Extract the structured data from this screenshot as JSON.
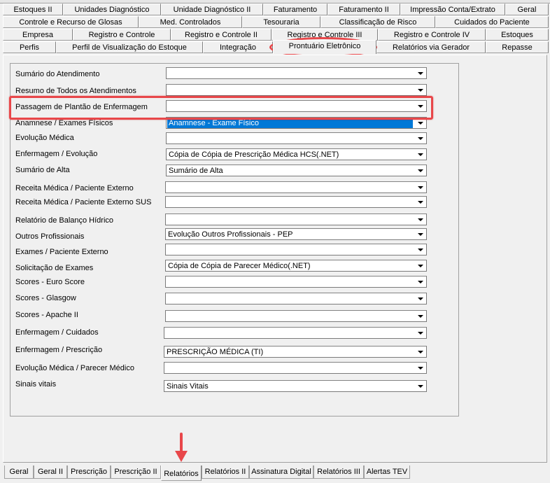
{
  "top_tabs": {
    "row1": [
      "Estoques II",
      "Unidades Diagnóstico",
      "Unidade Diagnóstico II",
      "Faturamento",
      "Faturamento II",
      "Impressão Conta/Extrato",
      "Geral"
    ],
    "row2": [
      "Controle e Recurso de Glosas",
      "Med. Controlados",
      "Tesouraria",
      "Classificação de Risco",
      "Cuidados do Paciente"
    ],
    "row3": [
      "Empresa",
      "Registro e Controle",
      "Registro e Controle II",
      "Registro e Controle III",
      "Registro e Controle IV",
      "Estoques"
    ],
    "row4": [
      "Perfis",
      "Perfil de Visualização do Estoque",
      "Integração",
      "Prontuário Eletrônico",
      "Relatórios via Gerador",
      "Repasse"
    ]
  },
  "fields": [
    {
      "label": "Sumário do Atendimento",
      "value": ""
    },
    {
      "label": "Resumo de Todos os Atendimentos",
      "value": ""
    },
    {
      "label": "Passagem de Plantão de Enfermagem",
      "value": ""
    },
    {
      "label": "Anamnese / Exames Físicos",
      "value": "Anamnese - Exame Físico"
    },
    {
      "label": "Evolução Médica",
      "value": ""
    },
    {
      "label": "Enfermagem / Evolução",
      "value": "Cópia de Cópia de Prescrição Médica HCS(.NET)"
    },
    {
      "label": "Sumário de Alta",
      "value": "Sumário de Alta"
    },
    {
      "label": "Receita Médica / Paciente Externo",
      "value": ""
    },
    {
      "label": " Receita Médica / Paciente Externo SUS",
      "value": ""
    },
    {
      "label": "Relatório de Balanço Hídrico",
      "value": ""
    },
    {
      "label": "Outros Profissionais",
      "value": "Evolução Outros Profissionais - PEP"
    },
    {
      "label": "Exames / Paciente Externo",
      "value": ""
    },
    {
      "label": "Solicitação de Exames",
      "value": "Cópia de Cópia de Parecer Médico(.NET)"
    },
    {
      "label": " Scores - Euro Score",
      "value": ""
    },
    {
      "label": "Scores - Glasgow",
      "value": ""
    },
    {
      "label": "Scores - Apache II",
      "value": ""
    },
    {
      "label": "Enfermagem / Cuidados",
      "value": ""
    },
    {
      "label": "Enfermagem / Prescrição",
      "value": "PRESCRIÇÃO MÉDICA (TI)"
    },
    {
      "label": "Evolução Médica / Parecer Médico",
      "value": ""
    },
    {
      "label": "Sinais vitais",
      "value": "Sinais Vitais"
    }
  ],
  "bottom_tabs": [
    "Geral",
    "Geral II",
    "Prescrição",
    "Prescrição II",
    "Relatórios",
    "Relatórios II",
    "Assinatura Digital",
    "Relatórios III",
    "Alertas TEV"
  ],
  "colors": {
    "highlight": "#e8474a",
    "selection": "#0078d7"
  }
}
